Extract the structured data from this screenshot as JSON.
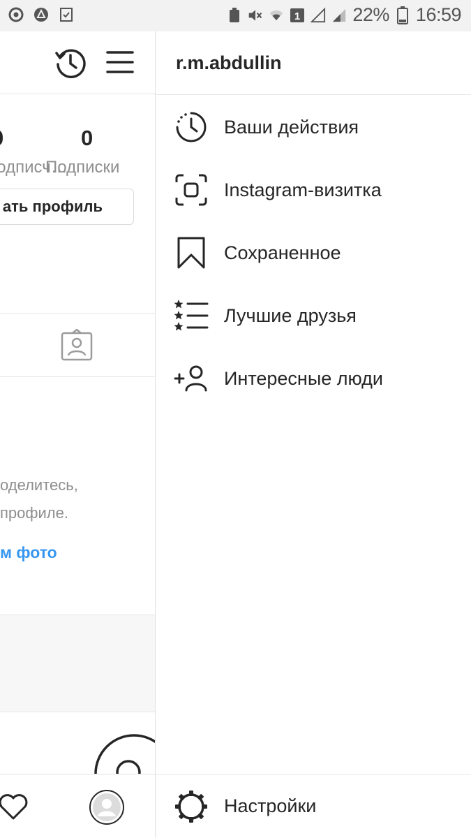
{
  "status_bar": {
    "icons_left": [
      "opera-icon",
      "drive-icon",
      "checklist-icon"
    ],
    "icons_right": [
      "recycle-icon",
      "mute-icon",
      "wifi-icon",
      "sim1-icon",
      "signal-icon",
      "signal-r-icon",
      "battery-icon"
    ],
    "battery": "22%",
    "time": "16:59"
  },
  "profile": {
    "followers_num": "0",
    "followers_label": "Подписч…",
    "following_num": "0",
    "following_label": "Подписки",
    "edit_button_label": "Редактировать профиль",
    "edit_button_visible": "ать профиль",
    "empty_text_line1": "оделитесь,",
    "empty_text_line2": "профиле.",
    "link_text": "м фото"
  },
  "drawer": {
    "username": "r.m.abdullin",
    "items": [
      {
        "label": "Ваши действия",
        "icon": "activity-clock-icon"
      },
      {
        "label": "Instagram-визитка",
        "icon": "nametag-scan-icon"
      },
      {
        "label": "Сохраненное",
        "icon": "bookmark-icon"
      },
      {
        "label": "Лучшие друзья",
        "icon": "close-friends-icon"
      },
      {
        "label": "Интересные люди",
        "icon": "add-person-icon"
      }
    ],
    "footer": {
      "label": "Настройки",
      "icon": "settings-gear-icon"
    }
  }
}
